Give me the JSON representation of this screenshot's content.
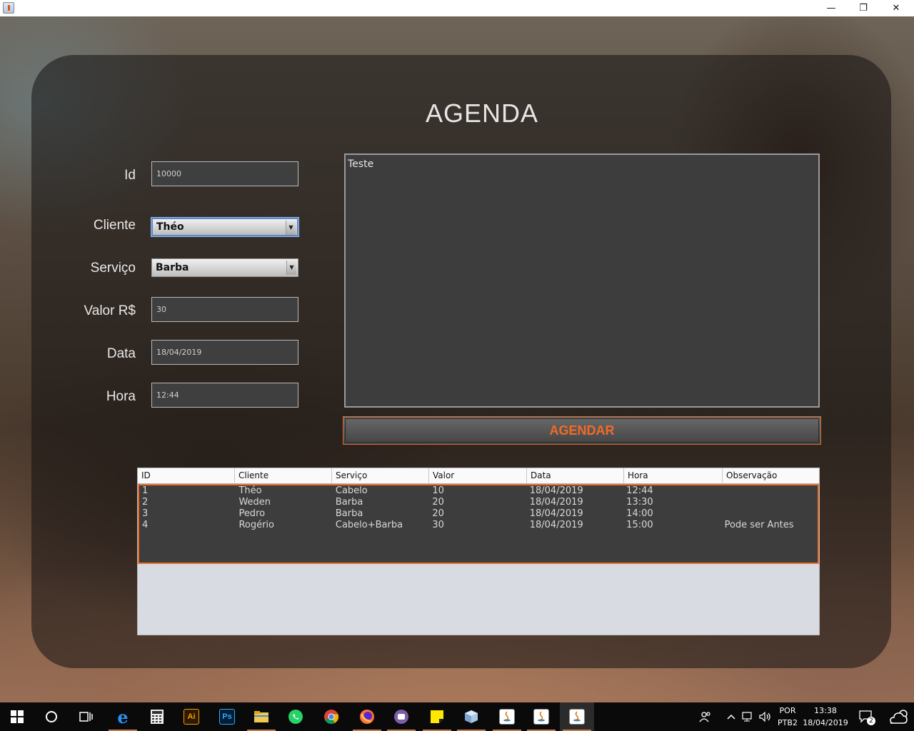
{
  "window": {
    "minimize": "—",
    "maximize": "❐",
    "close": "✕"
  },
  "page": {
    "title": "AGENDA"
  },
  "form": {
    "id_label": "Id",
    "id_value": "10000",
    "cliente_label": "Cliente",
    "cliente_value": "Théo",
    "servico_label": "Serviço",
    "servico_value": "Barba",
    "valor_label": "Valor R$",
    "valor_value": "30",
    "data_label": "Data",
    "data_value": "18/04/2019",
    "hora_label": "Hora",
    "hora_value": "12:44",
    "observacao_value": "Teste",
    "submit_label": "AGENDAR"
  },
  "table": {
    "columns": [
      "ID",
      "Cliente",
      "Serviço",
      "Valor",
      "Data",
      "Hora",
      "Observação"
    ],
    "rows": [
      [
        "1",
        "Théo",
        "Cabelo",
        "10",
        "18/04/2019",
        "12:44",
        ""
      ],
      [
        "2",
        "Weden",
        "Barba",
        "20",
        "18/04/2019",
        "13:30",
        ""
      ],
      [
        "3",
        "Pedro",
        "Barba",
        "20",
        "18/04/2019",
        "14:00",
        ""
      ],
      [
        "4",
        "Rogério",
        "Cabelo+Barba",
        "30",
        "18/04/2019",
        "15:00",
        "Pode ser Antes"
      ]
    ]
  },
  "taskbar": {
    "apps": [
      "start-icon",
      "cortana-icon",
      "task-view-icon",
      "edge-icon",
      "calculator-icon",
      "illustrator-icon",
      "photoshop-icon",
      "file-explorer-icon",
      "whatsapp-icon",
      "chrome-icon",
      "firefox-icon",
      "teams-icon",
      "sticky-notes-icon",
      "virtualbox-icon",
      "java-icon",
      "java-icon",
      "java-icon"
    ],
    "illustrator_label": "Ai",
    "photoshop_label": "Ps",
    "lang_top": "POR",
    "lang_bottom": "PTB2",
    "time": "13:38",
    "date": "18/04/2019",
    "notification_count": "2"
  },
  "colors": {
    "accent": "#e5702f",
    "panel": "#3d3d3d",
    "field_border": "#b9b9b9"
  }
}
